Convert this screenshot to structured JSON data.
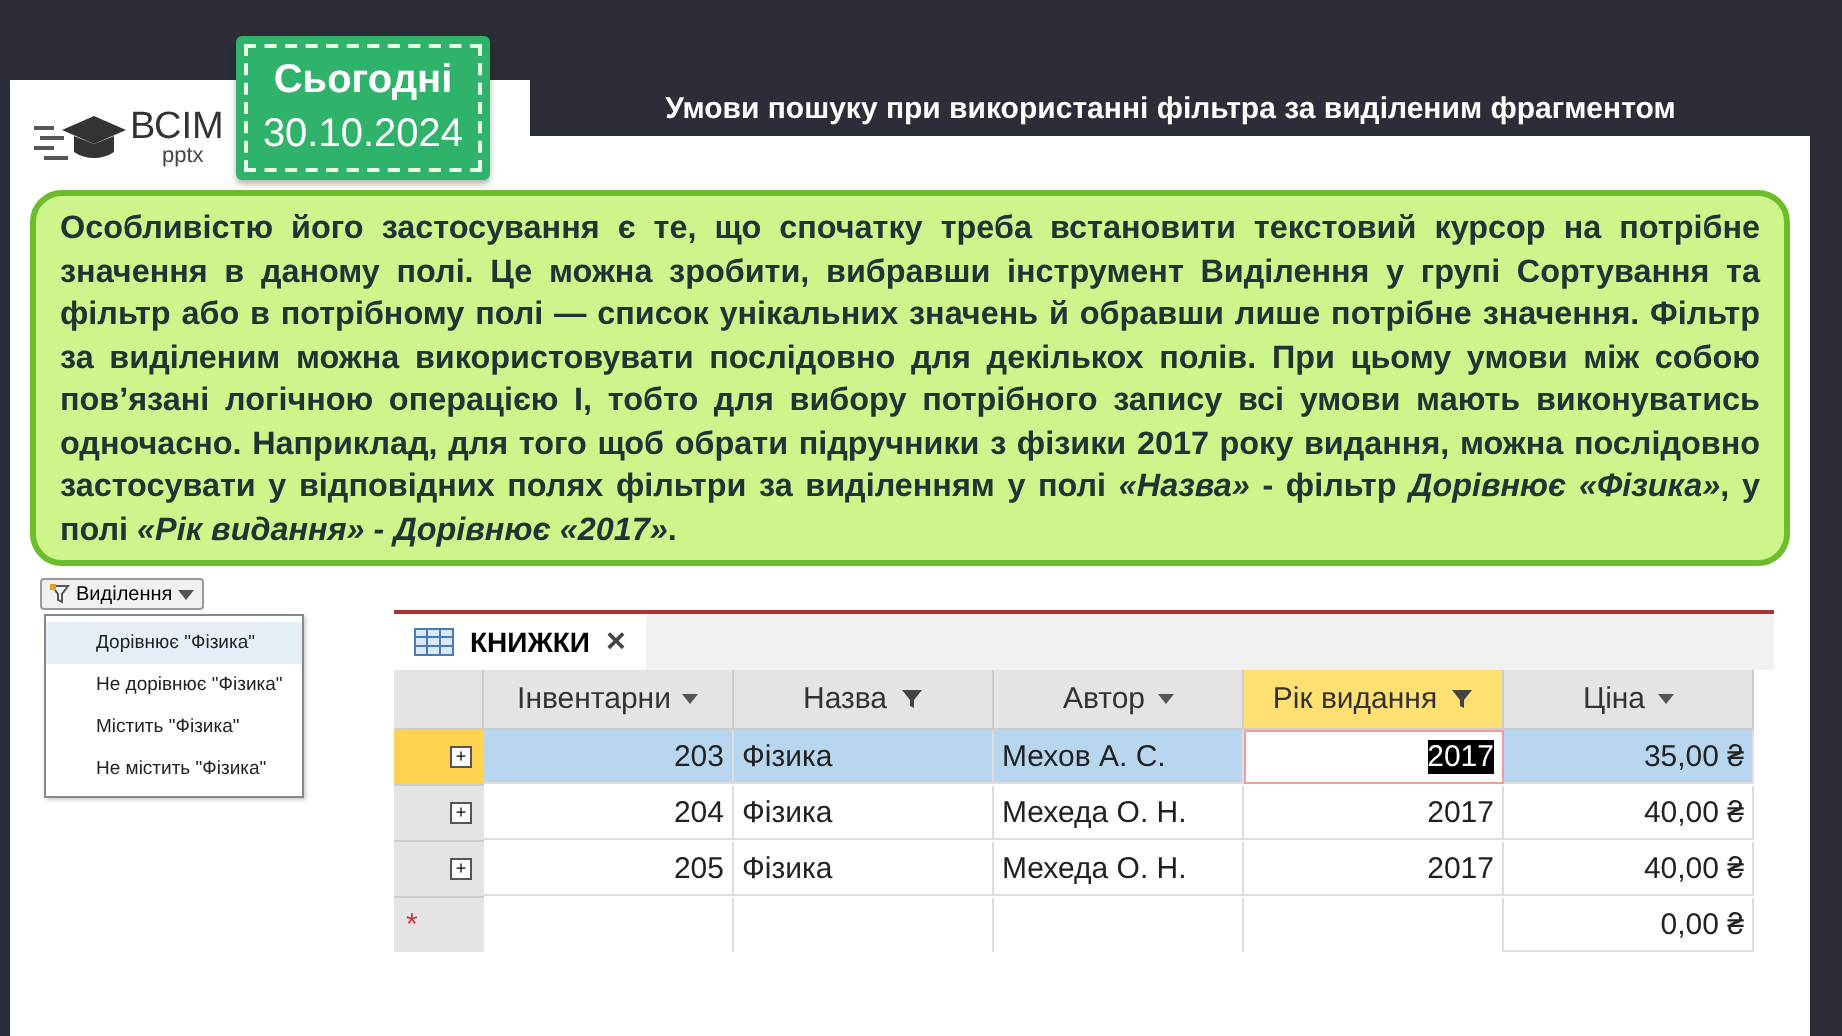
{
  "logo": {
    "brand": "ВСІМ",
    "sub": "pptx"
  },
  "date_badge": {
    "label": "Сьогодні",
    "date": "30.10.2024"
  },
  "title": "Умови пошуку при використанні фільтра за виділеним фрагментом",
  "paragraph": "Особливістю його застосування є те, що спочатку треба встановити текстовий курсор на потрібне значення в даному полі. Це можна зробити, вибравши інструмент Виділення у групі Сортування та фільтр або в потрібному полі — список унікальних значень й обравши лише потрібне значення. Фільтр за виділеним можна використовувати послідовно для декількох полів. При цьому умови між собою пов’язані логічною операцією І, тобто для вибору потрібного запису всі умови мають виконуватись одночасно. Наприклад, для того щоб обрати підручники з фізики 2017 року видання, можна послідовно застосувати у відповідних полях фільтри за виділенням у полі *«Назва»*  - фільтр *Дорівнює «Фізика»*, у полі *«Рік видання» - Дорівнює «2017»*.",
  "selection_menu": {
    "button": "Виділення",
    "items": [
      {
        "label": "Дорівнює \"Фізика\"",
        "selected": true
      },
      {
        "label": "Не дорівнює \"Фізика\"",
        "selected": false
      },
      {
        "label": "Містить \"Фізика\"",
        "selected": false
      },
      {
        "label": "Не містить \"Фізика\"",
        "selected": false
      }
    ]
  },
  "table": {
    "tab": "КНИЖКИ",
    "tab_close": "×",
    "columns": [
      {
        "label": "Інвентарни",
        "filtered": false,
        "active": false
      },
      {
        "label": "Назва",
        "filtered": true,
        "active": false
      },
      {
        "label": "Автор",
        "filtered": false,
        "active": false
      },
      {
        "label": "Рік видання",
        "filtered": true,
        "active": true
      },
      {
        "label": "Ціна",
        "filtered": false,
        "active": false
      }
    ],
    "rows": [
      {
        "expander": "+",
        "cells": [
          "203",
          "Фізика",
          "Мехов А. С.",
          "2017",
          "35,00 ₴"
        ],
        "selected": true
      },
      {
        "expander": "+",
        "cells": [
          "204",
          "Фізика",
          "Мехеда О. Н.",
          "2017",
          "40,00 ₴"
        ],
        "selected": false
      },
      {
        "expander": "+",
        "cells": [
          "205",
          "Фізика",
          "Мехеда О. Н.",
          "2017",
          "40,00 ₴"
        ],
        "selected": false
      }
    ],
    "new_row": {
      "marker": "*",
      "price": "0,00 ₴"
    }
  }
}
